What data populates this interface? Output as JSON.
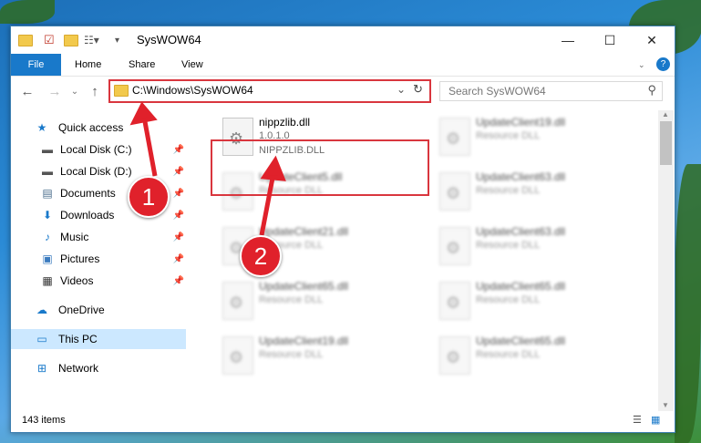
{
  "window": {
    "title": "SysWOW64",
    "min": "—",
    "max": "☐",
    "close": "✕"
  },
  "ribbon": {
    "file": "File",
    "home": "Home",
    "share": "Share",
    "view": "View"
  },
  "nav": {
    "address": "C:\\Windows\\SysWOW64",
    "search_placeholder": "Search SysWOW64"
  },
  "sidebar": {
    "items": [
      {
        "label": "Quick access",
        "icon": "star-icon"
      },
      {
        "label": "Local Disk (C:)",
        "icon": "drive-icon"
      },
      {
        "label": "Local Disk (D:)",
        "icon": "drive-icon"
      },
      {
        "label": "Documents",
        "icon": "documents-icon"
      },
      {
        "label": "Downloads",
        "icon": "download-icon"
      },
      {
        "label": "Music",
        "icon": "music-icon"
      },
      {
        "label": "Pictures",
        "icon": "pictures-icon"
      },
      {
        "label": "Videos",
        "icon": "videos-icon"
      },
      {
        "label": "OneDrive",
        "icon": "cloud-icon"
      },
      {
        "label": "This PC",
        "icon": "computer-icon"
      },
      {
        "label": "Network",
        "icon": "network-icon"
      }
    ]
  },
  "files": [
    {
      "name": "nippzlib.dll",
      "line2": "1.0.1.0",
      "line3": "NIPPZLIB.DLL"
    },
    {
      "name": "UpdateClient19.dll",
      "line2": "Resource DLL"
    },
    {
      "name": "UpdateClient5.dll",
      "line2": "Resource DLL"
    },
    {
      "name": "UpdateClient63.dll",
      "line2": "Resource DLL"
    },
    {
      "name": "UpdateClient21.dll",
      "line2": "Resource DLL"
    },
    {
      "name": "UpdateClient63.dll",
      "line2": "Resource DLL"
    },
    {
      "name": "UpdateClient65.dll",
      "line2": "Resource DLL"
    },
    {
      "name": "UpdateClient65.dll",
      "line2": "Resource DLL"
    },
    {
      "name": "UpdateClient19.dll",
      "line2": "Resource DLL"
    },
    {
      "name": "UpdateClient65.dll",
      "line2": "Resource DLL"
    }
  ],
  "status": {
    "count": "143 items"
  },
  "annotations": {
    "step1": "1",
    "step2": "2"
  },
  "colors": {
    "accent": "#1979ca",
    "highlight": "#d9363e",
    "selected": "#cce8ff"
  }
}
